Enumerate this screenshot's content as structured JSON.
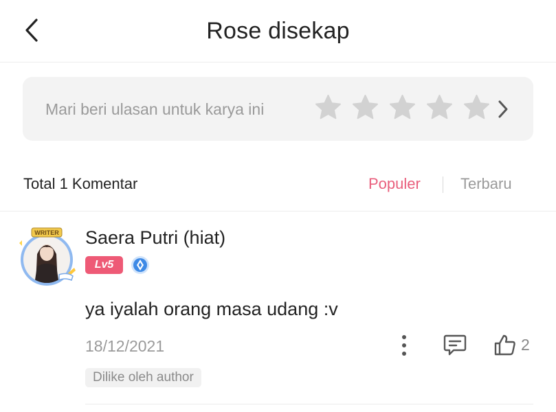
{
  "header": {
    "title": "Rose disekap",
    "back_icon": "chevron-left-icon"
  },
  "review": {
    "prompt": "Mari beri ulasan untuk karya ini",
    "star_count": 5,
    "star_color": "#d2d2d2"
  },
  "comments_header": {
    "total": "Total 1 Komentar",
    "sort_popular": "Populer",
    "sort_latest": "Terbaru",
    "active_color": "#e95f7d"
  },
  "comment": {
    "username": "Saera Putri (hiat)",
    "avatar_frame_text": "WRITER",
    "level": "Lv5",
    "text": "ya iyalah orang masa udang :v",
    "date": "18/12/2021",
    "likes": "2",
    "author_liked": "Dilike oleh author"
  }
}
